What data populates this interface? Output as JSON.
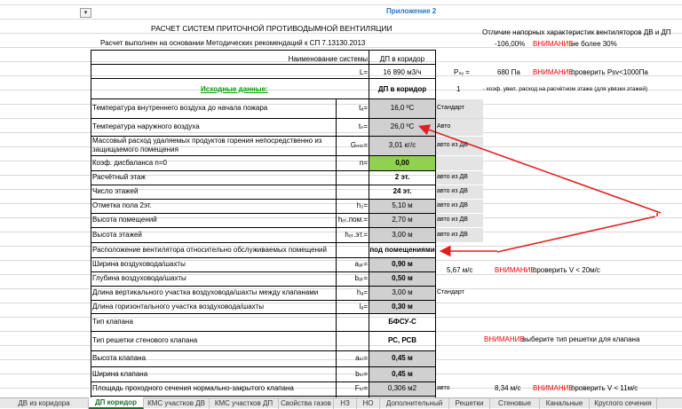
{
  "sheet": {
    "appendix": "Приложение 2",
    "title": "РАСЧЕТ СИСТЕМ ПРИТОЧНОЙ ПРОТИВОДЫМНОЙ ВЕНТИЛЯЦИИ",
    "subtitle": "Расчет выполнен на основании Методических рекомендаций к СП 7.13130.2013",
    "side_title": "Отличие напорных характеристик вентиляторов ДВ и ДП",
    "side_percent": "-106,00%",
    "side_warning_word": "ВНИМАНИЕ",
    "side_warning_text": "не более 30%",
    "system_name_label": "Наименование системы",
    "system_name_value": "ДП в коридор",
    "L_label": "L=",
    "L_value": "16 890 м3/ч",
    "Psv_label": "Pₛᵥ =",
    "Psv_value": "680 Па",
    "Psv_warning_word": "ВНИМАНИЕ",
    "Psv_warning_text": "проверить Psv<1000Па",
    "initial_label": "Исходные данные:",
    "initial_value": "ДП в коридор",
    "coef_value": "1",
    "coef_note": "- коэф. увел. расход на расчётном этаже (для увязки этажей)",
    "rows": [
      {
        "label": "Температура внутреннего воздуха до начала пожара",
        "sym": "tₐ=",
        "val": "16,0 ºC",
        "note": "Стандарт"
      },
      {
        "label": "Температура наружного воздуха",
        "sym": "tₙ=",
        "val": "26,0 ºC",
        "note": "Авто"
      },
      {
        "label": "Массовый расход удаляемых продуктов горения непосредственно из",
        "label2": "защищаемого помещения",
        "sym": "Gₘₕ=",
        "val": "3,01 кг/с",
        "note": "авто из ДВ"
      },
      {
        "label": "Коэф. дисбаланса n=0",
        "sym": "n=",
        "val": "0,00",
        "note": ""
      },
      {
        "label": "Расчётный этаж",
        "sym": "",
        "val": "2 эт.",
        "note": "авто из ДВ"
      },
      {
        "label": "Число этажей",
        "sym": "",
        "val": "24 эт.",
        "note": "авто из ДВ"
      },
      {
        "label": "Отметка пола 2эт.",
        "sym": "h₂=",
        "val": "5,10 м",
        "note": "авто из ДВ"
      },
      {
        "label": "Высота помещений",
        "sym": "hₑₜ.пом.=",
        "val": "2,70 м",
        "note": "авто из ДВ"
      },
      {
        "label": "Высота этажей",
        "sym": "hₑₜ.эт.=",
        "val": "3,00 м",
        "note": "авто из ДВ"
      },
      {
        "label": "Расположение вентилятора относительно обслуживаемых помещений",
        "sym": "",
        "val": "под помещениями",
        "note": ""
      },
      {
        "label": "Ширина воздуховода/шахты",
        "sym": "aₐₜ=",
        "val": "0,90 м",
        "note": ""
      },
      {
        "label": "Глубина воздуховода/шахты",
        "sym": "bₐₜ=",
        "val": "0,50 м",
        "note": ""
      },
      {
        "label": "Длина вертикального участка воздуховода/шахты между клапанами",
        "sym": "hₐ=",
        "val": "3,00 м",
        "note": "Стандарт"
      },
      {
        "label": "Длина горизонтального участка воздуховода/шахты",
        "sym": "lₐ=",
        "val": "0,30 м",
        "note": ""
      },
      {
        "label": "Тип клапана",
        "sym": "",
        "val": "БФСУ-С",
        "note": ""
      },
      {
        "label": "Тип решетки стенового клапана",
        "sym": "",
        "val": "РС, РСВ",
        "note": ""
      },
      {
        "label": "Высота клапана",
        "sym": "aₖₗ=",
        "val": "0,45 м",
        "note": ""
      },
      {
        "label": "Ширина клапана",
        "sym": "bₖₗ=",
        "val": "0,45 м",
        "note": ""
      },
      {
        "label": "Площадь проходного сечения нормально-закрытого клапана",
        "sym": "Fₖₗ=",
        "val": "0,306 м2",
        "note": "авто"
      }
    ],
    "speed1_value": "5,67 м/с",
    "speed1_warning_word": "ВНИМАНИЕ",
    "speed1_warning_text": "проверить V < 20м/с",
    "grate_warning_word": "ВНИМАНИЕ",
    "grate_warning_text": "выберите тип решетки для клапана",
    "speed2_value": "8,34 м/с",
    "speed2_warning_word": "ВНИМАНИЕ",
    "speed2_warning_text": "проверить V < 11м/с"
  },
  "tabs": [
    "ДВ из коридора",
    "ДП коридор",
    "КМС участков ДВ",
    "КМС участков ДП",
    "Свойства газов",
    "НЗ",
    "НО",
    "Дополнительный",
    "Решетки",
    "Стеновые",
    "Канальные",
    "Круглого сечения"
  ],
  "active_tab": "ДП коридор",
  "colors": {
    "warning": "#ee0000",
    "green_cell": "#92d050",
    "gray_cell": "#d0d0d0",
    "accent_tab": "#1d6b2c",
    "appendix": "#1f78c8",
    "initial_label": "#00a000",
    "arrows": "#e02020"
  }
}
